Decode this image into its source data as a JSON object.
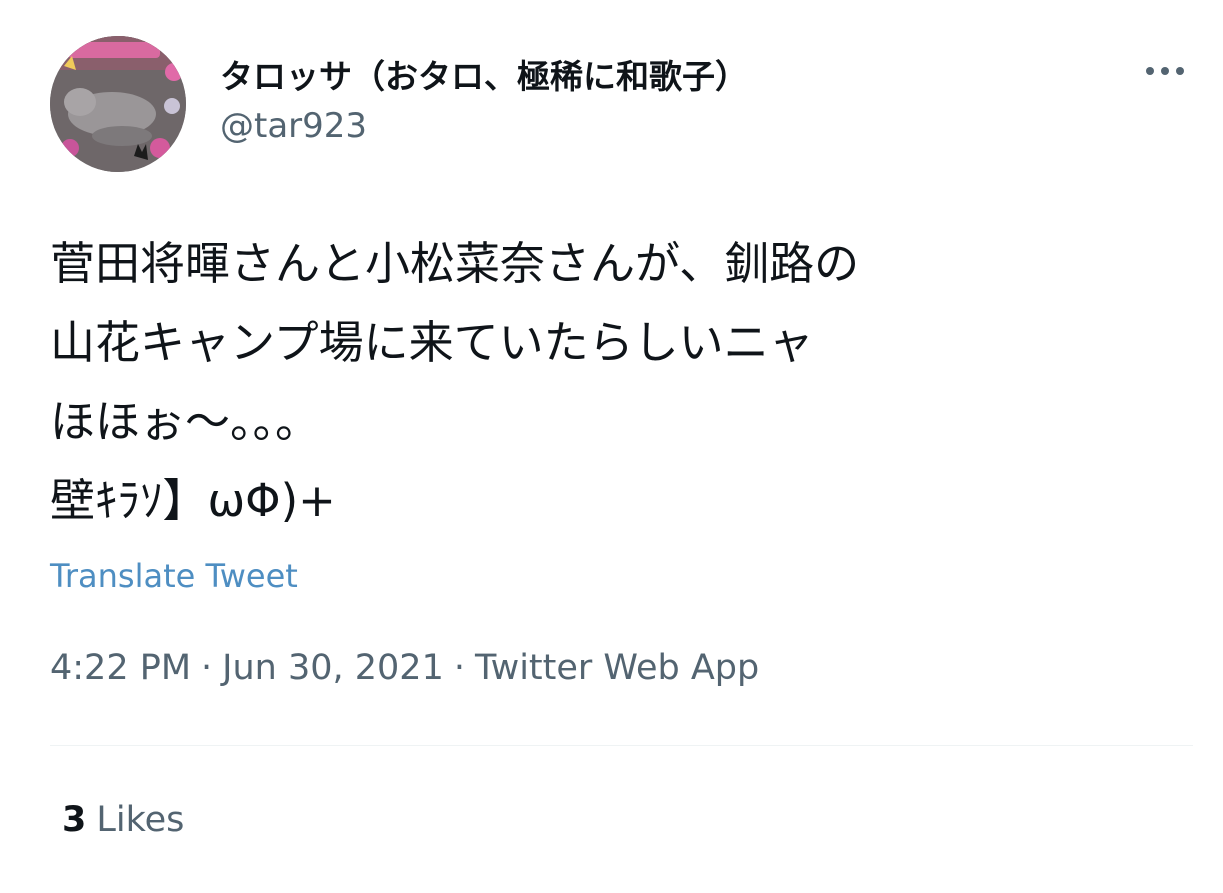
{
  "author": {
    "display_name": "タロッサ（おタロ、極稀に和歌子）",
    "handle": "@tar923",
    "avatar_icon": "cat-photo-avatar"
  },
  "more_icon": "more-horizontal-icon",
  "tweet": {
    "lines": [
      "菅田将暉さんと小松菜奈さんが、釧路の",
      "山花キャンプ場に来ていたらしいニャ",
      "ほほぉ〜。。。",
      "壁ｷﾗｿ】ωΦ)+"
    ],
    "translate_label": "Translate Tweet"
  },
  "meta": {
    "time": "4:22 PM",
    "separator": "·",
    "date": "Jun 30, 2021",
    "source": "Twitter Web App"
  },
  "engagement": {
    "likes_count": "3",
    "likes_label": "Likes"
  },
  "colors": {
    "text_primary": "#0f1419",
    "text_secondary": "#536471",
    "link": "#4e8ec2",
    "divider": "#eff3f4"
  }
}
